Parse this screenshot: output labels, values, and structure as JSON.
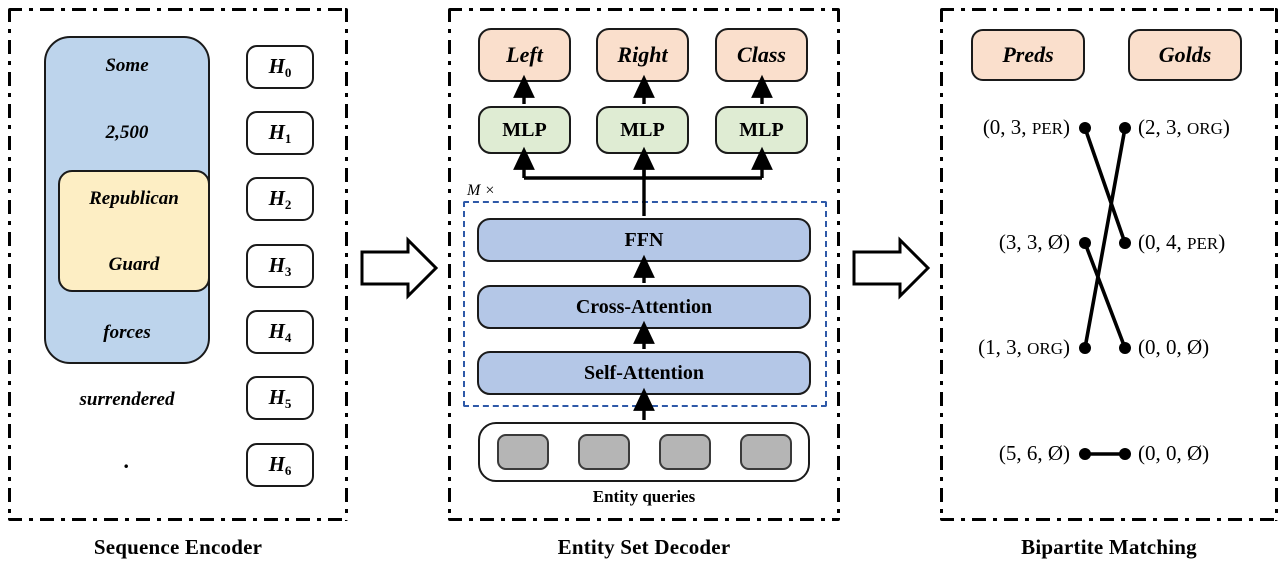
{
  "panels": [
    {
      "caption": "Sequence Encoder"
    },
    {
      "caption": "Entity Set Decoder"
    },
    {
      "caption": "Bipartite Matching"
    }
  ],
  "encoder": {
    "words": [
      "Some",
      "2,500",
      "Republican",
      "Guard",
      "forces",
      "surrendered",
      "."
    ],
    "entity_span": [
      "Republican",
      "Guard"
    ],
    "hidden_states": [
      {
        "base": "H",
        "sub": "0"
      },
      {
        "base": "H",
        "sub": "1"
      },
      {
        "base": "H",
        "sub": "2"
      },
      {
        "base": "H",
        "sub": "3"
      },
      {
        "base": "H",
        "sub": "4"
      },
      {
        "base": "H",
        "sub": "5"
      },
      {
        "base": "H",
        "sub": "6"
      }
    ],
    "context_color": "#bdd4ec",
    "entity_color": "#fdeec4"
  },
  "decoder": {
    "outputs": [
      "Left",
      "Right",
      "Class"
    ],
    "heads": [
      "MLP",
      "MLP",
      "MLP"
    ],
    "layers": [
      "FFN",
      "Cross-Attention",
      "Self-Attention"
    ],
    "repeat_label": "M ×",
    "queries_label": "Entity queries",
    "query_count": 4,
    "output_color": "#fadfcc",
    "head_color": "#dfecd3",
    "layer_color": "#b4c7e7",
    "repeat_border_color": "#2e59a8",
    "query_color": "#b5b5b5"
  },
  "matching": {
    "preds_header": "Preds",
    "golds_header": "Golds",
    "header_color": "#fadfcc",
    "preds": [
      {
        "left": "(0, 3, ",
        "tag": "PER",
        "right": ")"
      },
      {
        "left": "(3, 3, Ø",
        "tag": "",
        "right": ")"
      },
      {
        "left": "(1, 3, ",
        "tag": "ORG",
        "right": ")"
      },
      {
        "left": "(5, 6, Ø",
        "tag": "",
        "right": ")"
      }
    ],
    "golds": [
      {
        "left": "(2, 3, ",
        "tag": "ORG",
        "right": ")"
      },
      {
        "left": "(0, 4, ",
        "tag": "PER",
        "right": ")"
      },
      {
        "left": "(0, 0, Ø",
        "tag": "",
        "right": ")"
      },
      {
        "left": "(0, 0, Ø",
        "tag": "",
        "right": ")"
      }
    ],
    "edges": [
      {
        "pred_index": 0,
        "gold_index": 1
      },
      {
        "pred_index": 2,
        "gold_index": 0
      },
      {
        "pred_index": 1,
        "gold_index": 2
      },
      {
        "pred_index": 3,
        "gold_index": 3
      }
    ]
  },
  "flow_arrows": [
    {
      "name": "encoder-to-decoder"
    },
    {
      "name": "decoder-to-matching"
    }
  ]
}
